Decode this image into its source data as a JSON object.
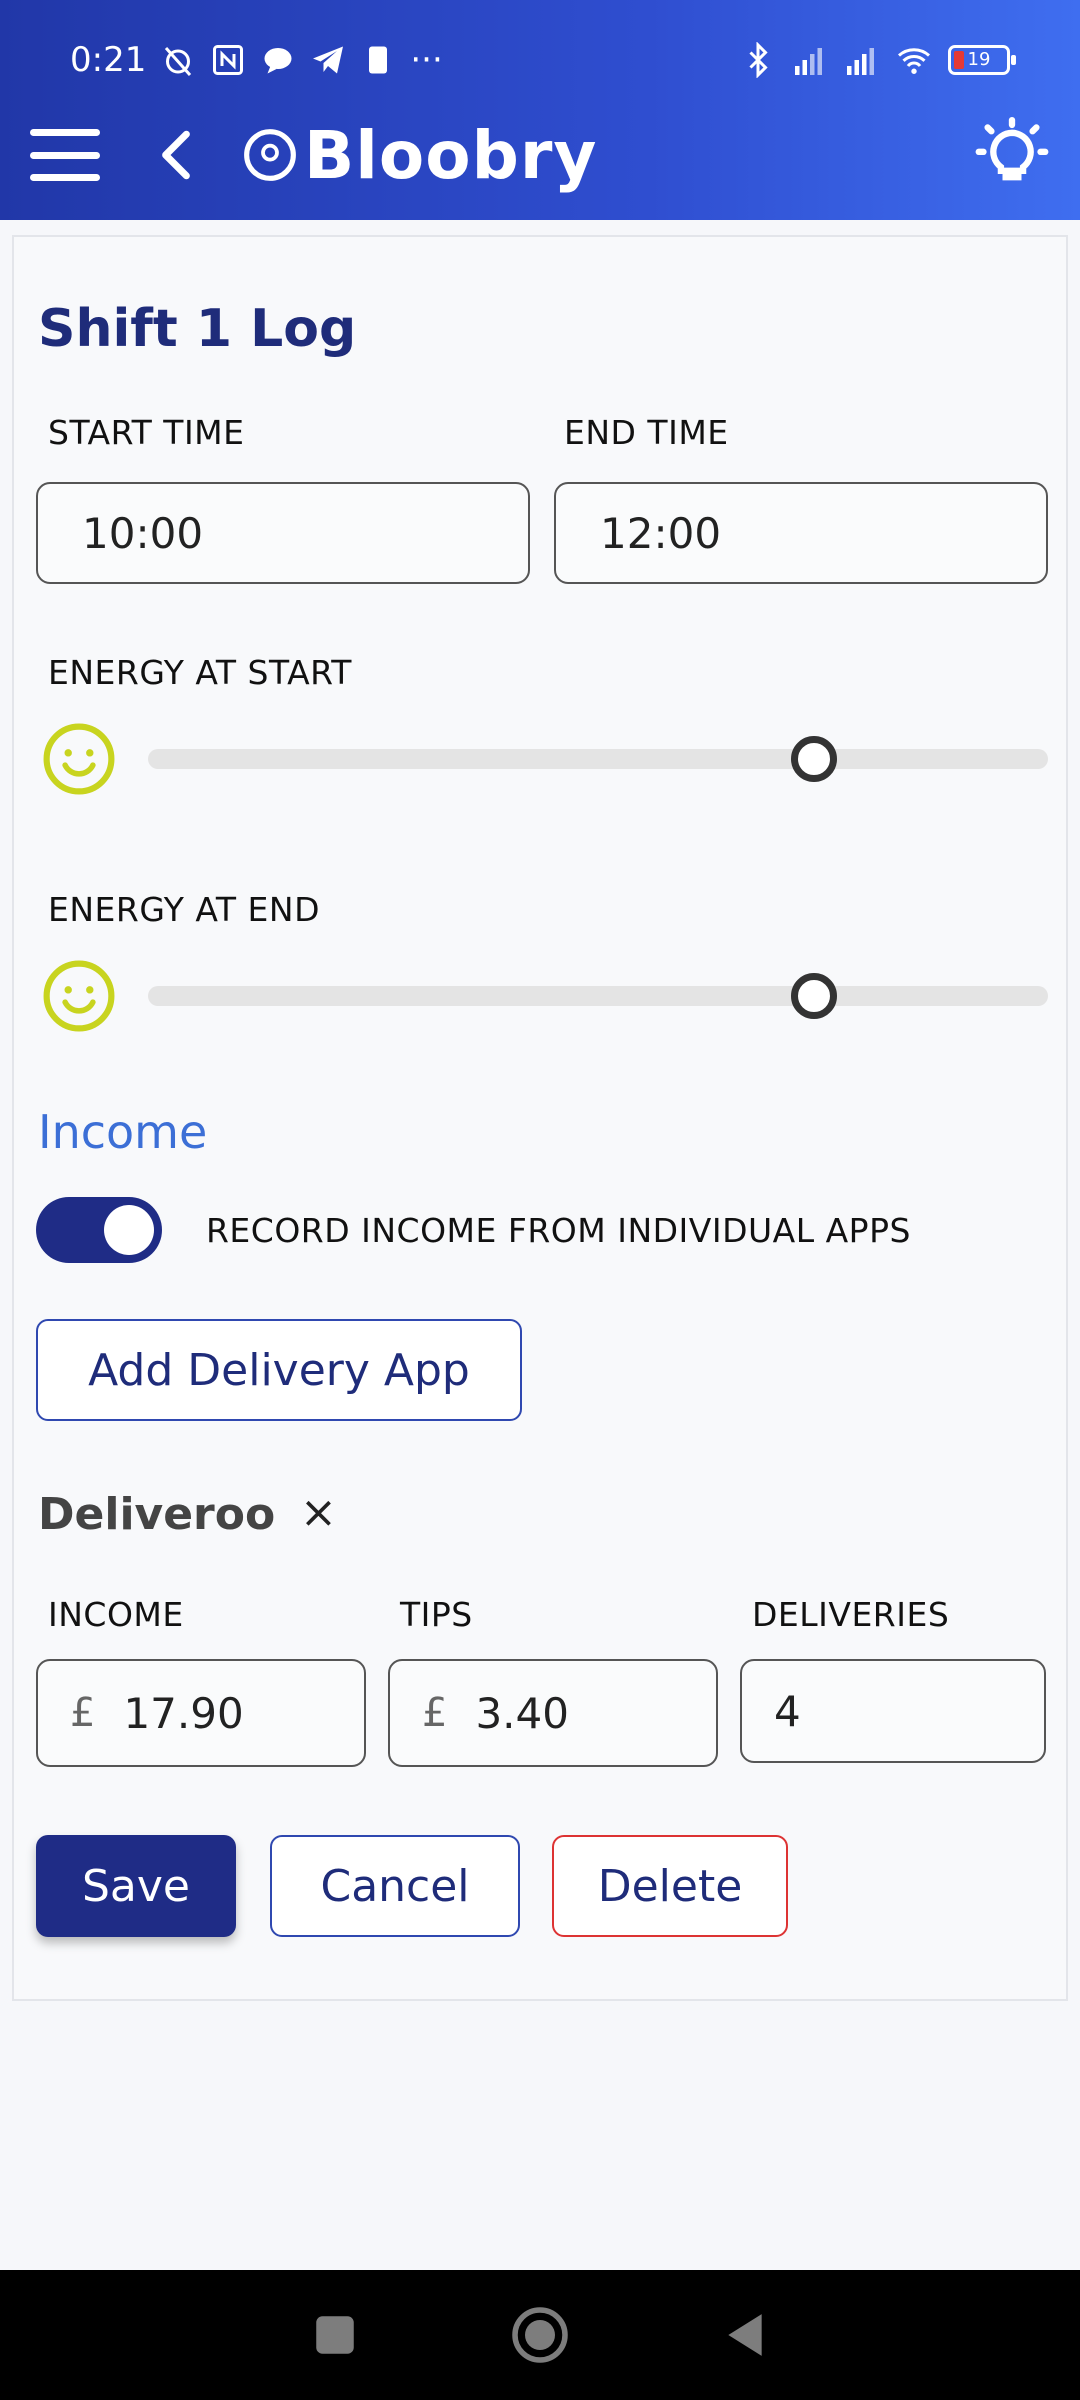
{
  "status": {
    "time": "0:21",
    "battery": "19"
  },
  "app": {
    "name": "Bloobry"
  },
  "shift": {
    "title": "Shift 1 Log",
    "start_time_label": "START TIME",
    "end_time_label": "END TIME",
    "start_time": "10:00",
    "end_time": "12:00",
    "energy_start_label": "ENERGY AT START",
    "energy_end_label": "ENERGY AT END",
    "energy_start_level": 0.74,
    "energy_end_level": 0.74
  },
  "income": {
    "section_title": "Income",
    "toggle_label": "RECORD INCOME FROM INDIVIDUAL APPS",
    "toggle_on": true,
    "add_app_label": "Add Delivery App",
    "app": {
      "name": "Deliveroo",
      "close": "×",
      "income_label": "INCOME",
      "tips_label": "TIPS",
      "deliveries_label": "DELIVERIES",
      "currency": "£",
      "income_value": "17.90",
      "tips_value": "3.40",
      "deliveries_value": "4"
    }
  },
  "actions": {
    "save": "Save",
    "cancel": "Cancel",
    "delete": "Delete"
  },
  "colors": {
    "header": "#2f4ed0",
    "primary": "#1f2c86",
    "accent": "#3c6fd6",
    "danger": "#dd3333",
    "smiley": "#c8d41f"
  }
}
